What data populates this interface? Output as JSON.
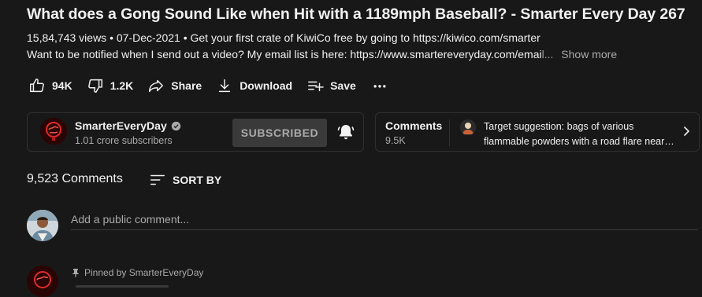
{
  "video": {
    "title": "What does a Gong Sound Like when Hit with a 1189mph Baseball? - Smarter Every Day 267",
    "views": "15,84,743 views",
    "date": "07-Dec-2021",
    "desc_line1": "Get your first crate of KiwiCo free by going to https://kiwico.com/smarter",
    "desc_line2_main": "Want to be notified when I send out a video?  My email list is here: https://www.smartereveryday.com/emai",
    "desc_line2_fade": "l...",
    "show_more": "Show more"
  },
  "actions": {
    "like_count": "94K",
    "dislike_count": "1.2K",
    "share_label": "Share",
    "download_label": "Download",
    "save_label": "Save"
  },
  "channel": {
    "name": "SmarterEveryDay",
    "subscribers": "1.01 crore subscribers",
    "subscribe_label": "SUBSCRIBED"
  },
  "comments_card": {
    "title": "Comments",
    "count": "9.5K",
    "preview_line1": "Target suggestion: bags of various",
    "preview_line2": "flammable powders with a road flare nearb..."
  },
  "comments": {
    "count_label": "9,523 Comments",
    "sort_label": "SORT BY",
    "input_placeholder": "Add a public comment...",
    "pinned_label": "Pinned by SmarterEveryDay"
  },
  "colors": {
    "background": "#181818",
    "text": "#f1f1f1",
    "secondary_text": "#aaaaaa",
    "channel_red": "#e02a2a"
  },
  "icons": [
    "like-icon",
    "dislike-icon",
    "share-icon",
    "download-icon",
    "save-playlist-icon",
    "more-icon",
    "verified-icon",
    "bell-icon",
    "chevron-right-icon",
    "sort-icon",
    "pin-icon"
  ]
}
